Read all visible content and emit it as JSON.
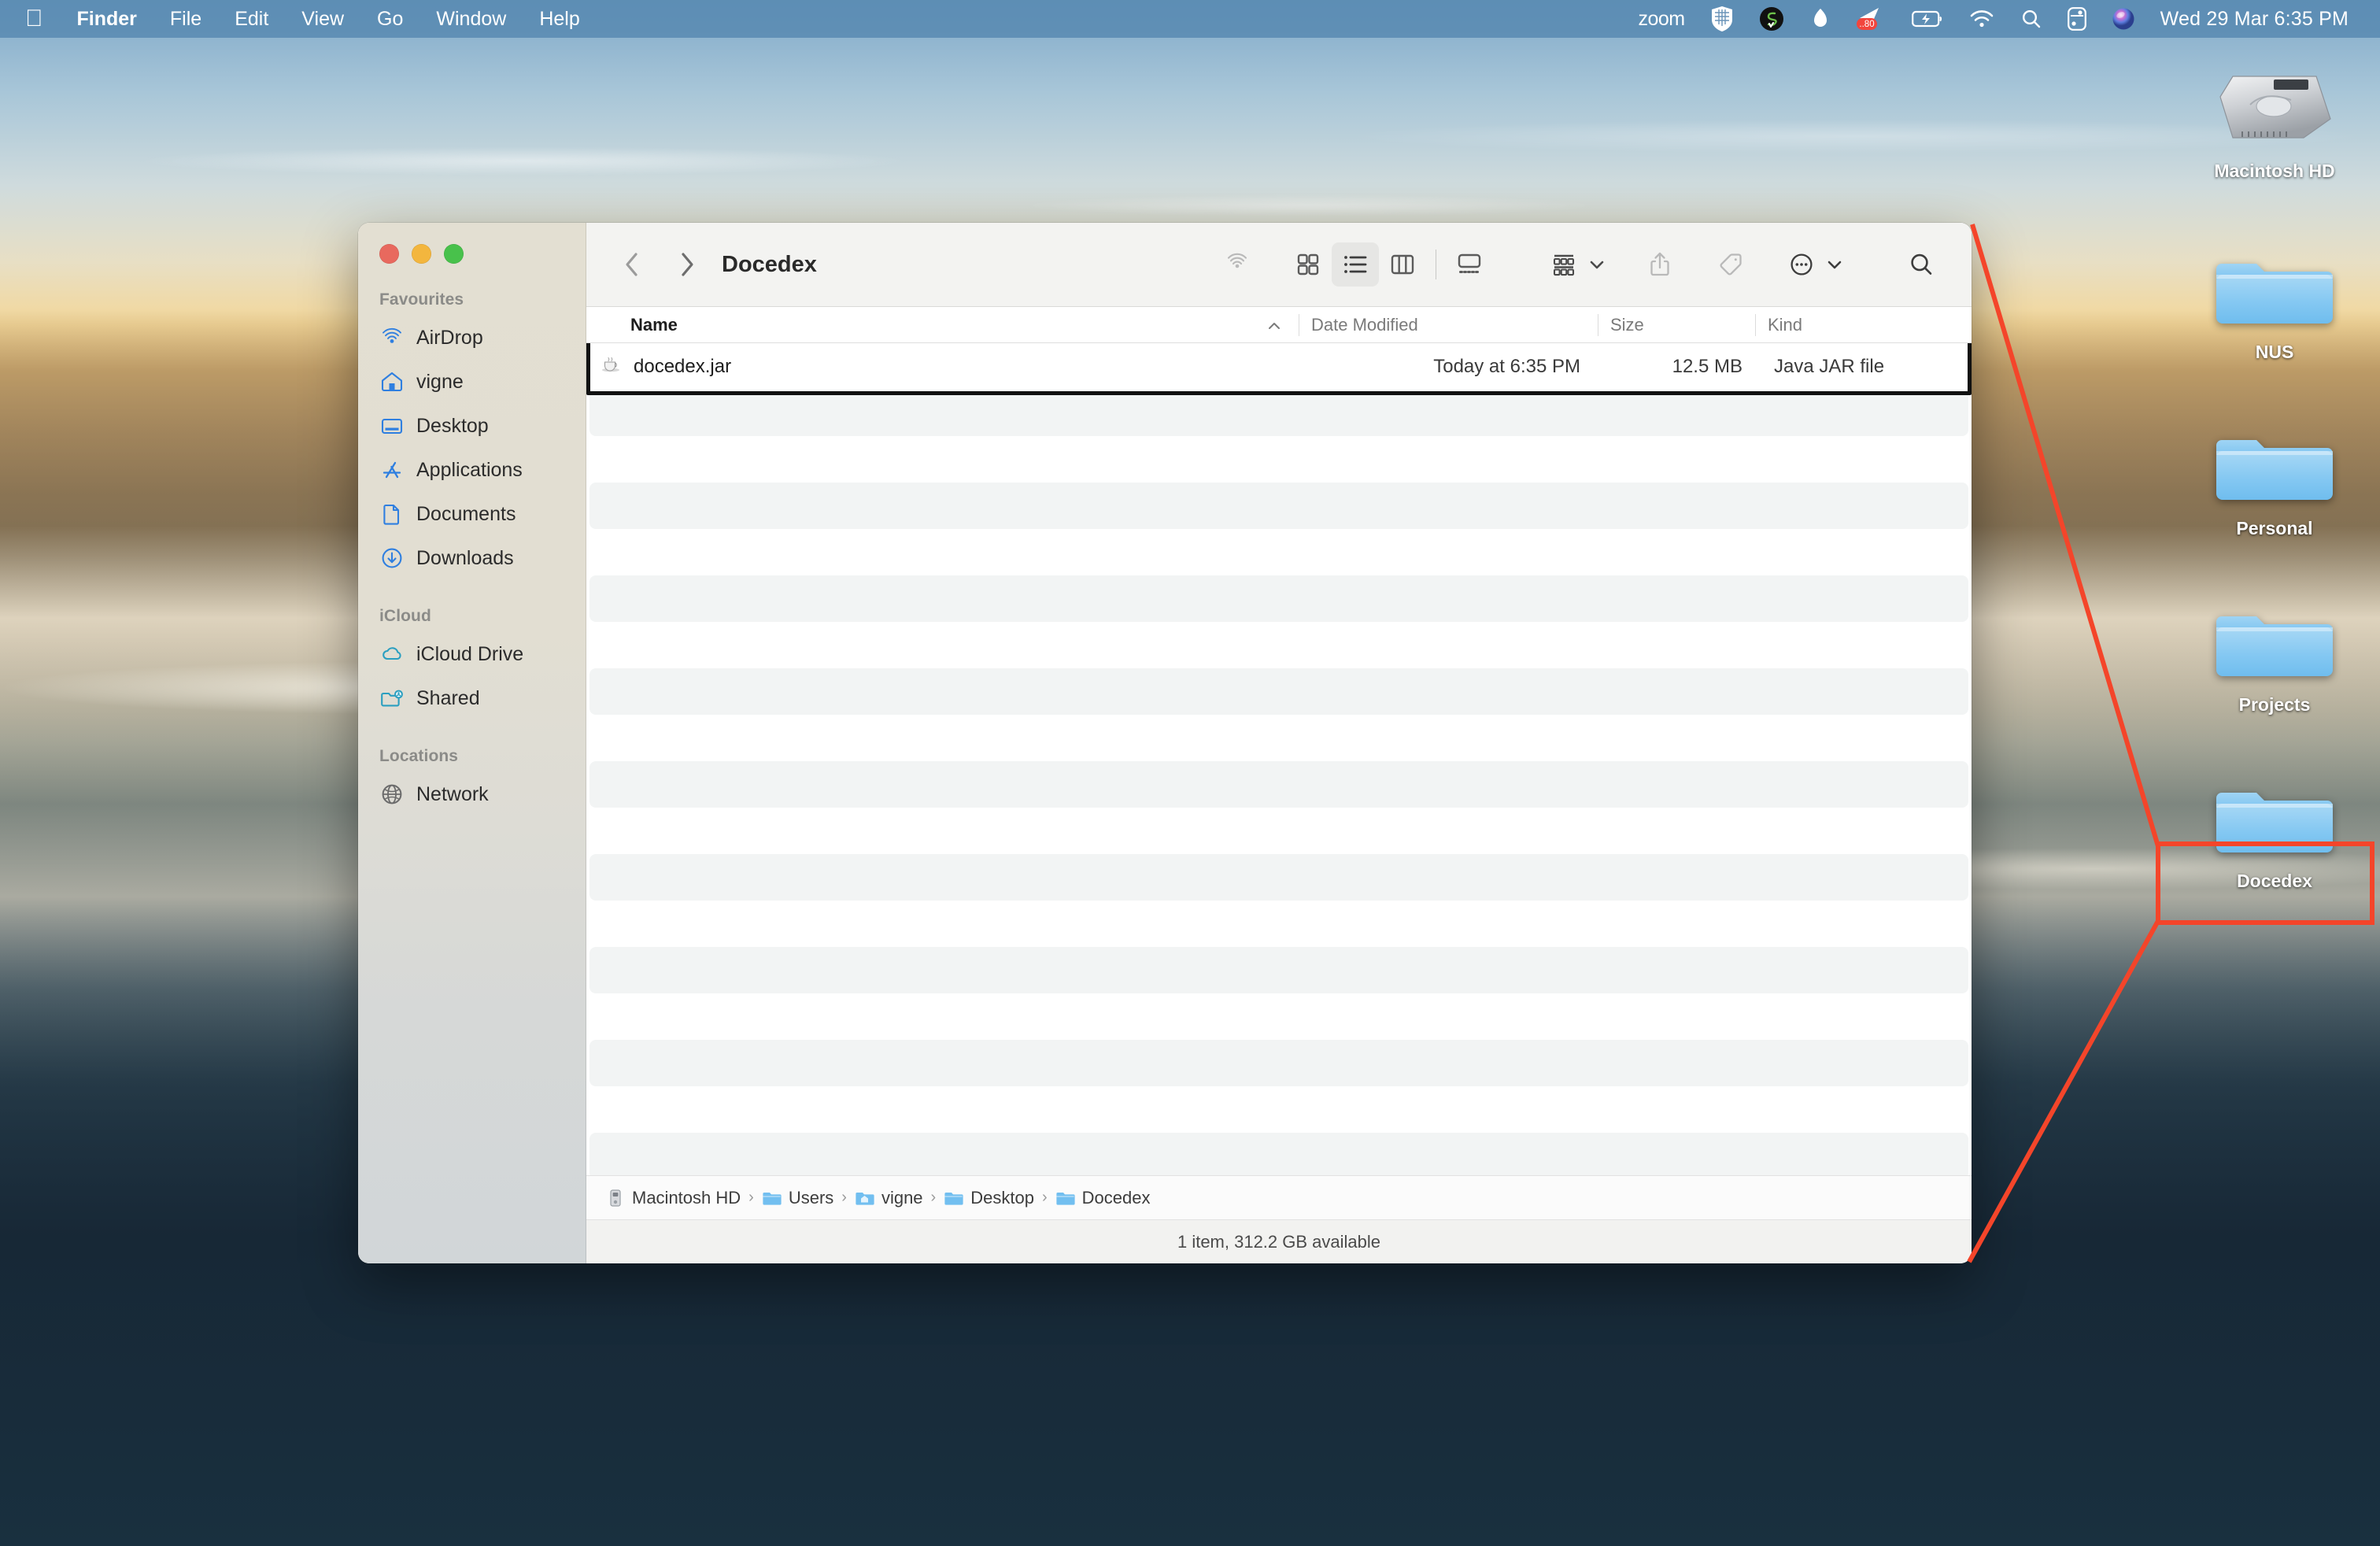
{
  "menubar": {
    "apple_glyph": "",
    "left_items": [
      {
        "label": "Finder",
        "bold": true,
        "name": "menu-finder"
      },
      {
        "label": "File",
        "bold": false,
        "name": "menu-file"
      },
      {
        "label": "Edit",
        "bold": false,
        "name": "menu-edit"
      },
      {
        "label": "View",
        "bold": false,
        "name": "menu-view"
      },
      {
        "label": "Go",
        "bold": false,
        "name": "menu-go"
      },
      {
        "label": "Window",
        "bold": false,
        "name": "menu-window"
      },
      {
        "label": "Help",
        "bold": false,
        "name": "menu-help"
      }
    ],
    "zoom_label": "zoom",
    "battery_badge": "..80",
    "clock": "Wed 29 Mar  6:35 PM",
    "status_icons": [
      "zoom-icon",
      "grid-app-icon",
      "spring-app-icon",
      "bell-icon",
      "paper-plane-icon",
      "battery-charging-icon",
      "wifi-icon",
      "search-icon",
      "control-center-icon",
      "siri-icon"
    ]
  },
  "desktop": {
    "icons": [
      {
        "label": "Macintosh HD",
        "type": "harddrive",
        "name": "desktop-icon-macintosh-hd"
      },
      {
        "label": "NUS",
        "type": "folder",
        "name": "desktop-icon-nus"
      },
      {
        "label": "Personal",
        "type": "folder",
        "name": "desktop-icon-personal"
      },
      {
        "label": "Projects",
        "type": "folder",
        "name": "desktop-icon-projects"
      },
      {
        "label": "Docedex",
        "type": "folder",
        "name": "desktop-icon-docedex"
      }
    ]
  },
  "annotation": {
    "color": "#f4452a",
    "highlight_color": "#111111"
  },
  "finder": {
    "title": "Docedex",
    "window_controls": [
      "close-button",
      "minimize-button",
      "maximize-button"
    ],
    "toolbar": {
      "back_label": "Back",
      "forward_label": "Forward",
      "buttons": [
        {
          "name": "airdrop-button",
          "enabled": false
        },
        {
          "name": "icon-view-button",
          "selected": false
        },
        {
          "name": "list-view-button",
          "selected": true
        },
        {
          "name": "column-view-button",
          "selected": false
        },
        {
          "name": "gallery-view-button",
          "selected": false
        },
        {
          "name": "group-by-button",
          "selected": false
        },
        {
          "name": "share-button",
          "enabled": false
        },
        {
          "name": "tag-button",
          "enabled": false
        },
        {
          "name": "more-actions-button",
          "selected": false
        },
        {
          "name": "search-button",
          "selected": false
        }
      ]
    },
    "columns": [
      {
        "key": "name",
        "label": "Name",
        "sorted": true,
        "sort_dir": "asc"
      },
      {
        "key": "date",
        "label": "Date Modified"
      },
      {
        "key": "size",
        "label": "Size"
      },
      {
        "key": "kind",
        "label": "Kind"
      }
    ],
    "files": [
      {
        "name": "docedex.jar",
        "date": "Today at 6:35 PM",
        "size": "12.5 MB",
        "kind": "Java JAR file",
        "icon": "java-jar-icon",
        "highlighted": true
      }
    ],
    "empty_row_count": 21,
    "pathbar": [
      {
        "label": "Macintosh HD",
        "icon": "harddrive-icon"
      },
      {
        "label": "Users",
        "icon": "folder-icon"
      },
      {
        "label": "vigne",
        "icon": "home-folder-icon"
      },
      {
        "label": "Desktop",
        "icon": "folder-icon"
      },
      {
        "label": "Docedex",
        "icon": "folder-icon"
      }
    ],
    "path_separator": "›",
    "status": "1 item, 312.2 GB available"
  },
  "sidebar": {
    "sections": [
      {
        "title": "Favourites",
        "name": "sidebar-section-favourites",
        "items": [
          {
            "label": "AirDrop",
            "icon": "airdrop-icon",
            "name": "sidebar-item-airdrop"
          },
          {
            "label": "vigne",
            "icon": "home-icon",
            "name": "sidebar-item-vigne"
          },
          {
            "label": "Desktop",
            "icon": "desktop-icon",
            "name": "sidebar-item-desktop"
          },
          {
            "label": "Applications",
            "icon": "applications-icon",
            "name": "sidebar-item-applications"
          },
          {
            "label": "Documents",
            "icon": "document-icon",
            "name": "sidebar-item-documents"
          },
          {
            "label": "Downloads",
            "icon": "downloads-icon",
            "name": "sidebar-item-downloads"
          }
        ]
      },
      {
        "title": "iCloud",
        "name": "sidebar-section-icloud",
        "items": [
          {
            "label": "iCloud Drive",
            "icon": "cloud-icon",
            "name": "sidebar-item-icloud-drive"
          },
          {
            "label": "Shared",
            "icon": "shared-folder-icon",
            "name": "sidebar-item-shared"
          }
        ]
      },
      {
        "title": "Locations",
        "name": "sidebar-section-locations",
        "items": [
          {
            "label": "Network",
            "icon": "globe-icon",
            "name": "sidebar-item-network"
          }
        ]
      }
    ]
  }
}
